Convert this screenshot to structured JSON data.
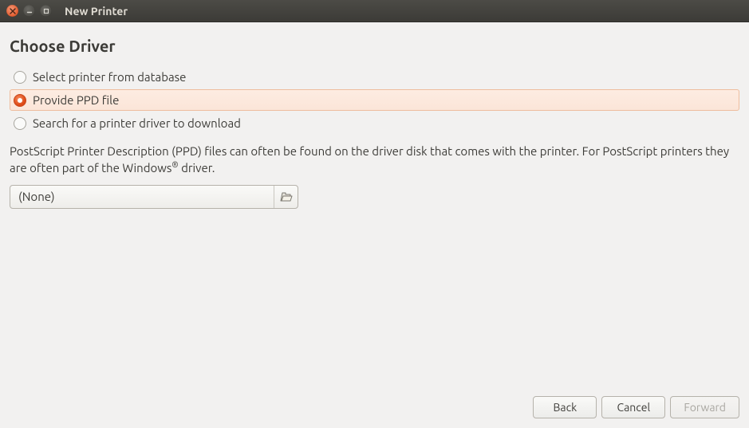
{
  "window": {
    "title": "New Printer"
  },
  "heading": "Choose Driver",
  "options": {
    "database": "Select printer from database",
    "ppd": "Provide PPD file",
    "search": "Search for a printer driver to download",
    "selected": "ppd"
  },
  "description": {
    "part1": "PostScript Printer Description (PPD) files can often be found on the driver disk that comes with the printer. For PostScript printers they are often part of the Windows",
    "reg": "®",
    "part2": " driver."
  },
  "file_picker": {
    "value": "(None)"
  },
  "buttons": {
    "back": "Back",
    "cancel": "Cancel",
    "forward": "Forward"
  }
}
